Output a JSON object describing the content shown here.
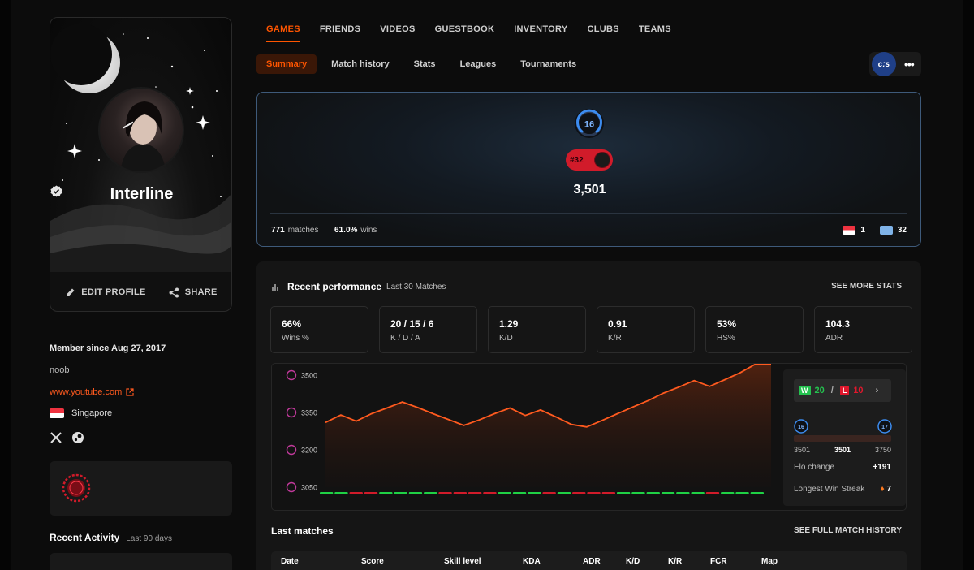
{
  "profile": {
    "name": "Interline",
    "edit_label": "EDIT PROFILE",
    "share_label": "SHARE",
    "member_since": "Member since Aug 27, 2017",
    "bio": "noob",
    "link": "www.youtube.com",
    "country": "Singapore",
    "recent_activity_title": "Recent Activity",
    "recent_activity_period": "Last 90 days"
  },
  "topnav": [
    "GAMES",
    "FRIENDS",
    "VIDEOS",
    "GUESTBOOK",
    "INVENTORY",
    "CLUBS",
    "TEAMS"
  ],
  "subnav": [
    "Summary",
    "Match history",
    "Stats",
    "Leagues",
    "Tournaments"
  ],
  "game_logo": "c:s",
  "more_label": "•••",
  "summary": {
    "level": "16",
    "rank": "#32",
    "elo": "3,501",
    "matches": "771",
    "matches_label": "matches",
    "wins": "61.0%",
    "wins_label": "wins",
    "country_rank": "1",
    "region_rank": "32"
  },
  "performance": {
    "title": "Recent performance",
    "subtitle": "Last 30 Matches",
    "see_more": "SEE MORE STATS",
    "stats": [
      {
        "value": "66%",
        "label": "Wins %"
      },
      {
        "value": "20 / 15 / 6",
        "label": "K / D / A"
      },
      {
        "value": "1.29",
        "label": "K/D"
      },
      {
        "value": "0.91",
        "label": "K/R"
      },
      {
        "value": "53%",
        "label": "HS%"
      },
      {
        "value": "104.3",
        "label": "ADR"
      }
    ],
    "side": {
      "w_tag": "W",
      "wins": "20",
      "sep": "/",
      "l_tag": "L",
      "losses": "10",
      "lvl_from": "16",
      "lvl_to": "17",
      "elo_min": "3501",
      "elo_cur": "3501",
      "elo_max": "3750",
      "elo_change_label": "Elo change",
      "elo_change": "+191",
      "streak_label": "Longest Win Streak",
      "streak": "7"
    }
  },
  "chart_data": {
    "type": "area",
    "yticks": [
      "3500",
      "3350",
      "3200",
      "3050"
    ],
    "ylim": [
      3050,
      3500
    ],
    "values": [
      3310,
      3340,
      3315,
      3345,
      3368,
      3392,
      3370,
      3345,
      3322,
      3298,
      3320,
      3345,
      3368,
      3338,
      3360,
      3332,
      3302,
      3292,
      3318,
      3345,
      3372,
      3398,
      3428,
      3452,
      3478,
      3455,
      3482,
      3510,
      3545,
      3545
    ],
    "results": [
      "W",
      "W",
      "L",
      "L",
      "W",
      "W",
      "W",
      "W",
      "L",
      "L",
      "L",
      "L",
      "W",
      "W",
      "W",
      "L",
      "W",
      "L",
      "L",
      "L",
      "W",
      "W",
      "W",
      "W",
      "W",
      "W",
      "L",
      "W",
      "W",
      "W"
    ],
    "colors": {
      "line": "#ff5a1f",
      "win": "#1fd145",
      "loss": "#d11b2a",
      "level_icon": "#c0399a"
    }
  },
  "last_matches": {
    "title": "Last matches",
    "see_full": "SEE FULL MATCH HISTORY",
    "columns": [
      "Date",
      "Score",
      "Skill level",
      "KDA",
      "ADR",
      "K/D",
      "K/R",
      "FCR",
      "Map"
    ]
  }
}
